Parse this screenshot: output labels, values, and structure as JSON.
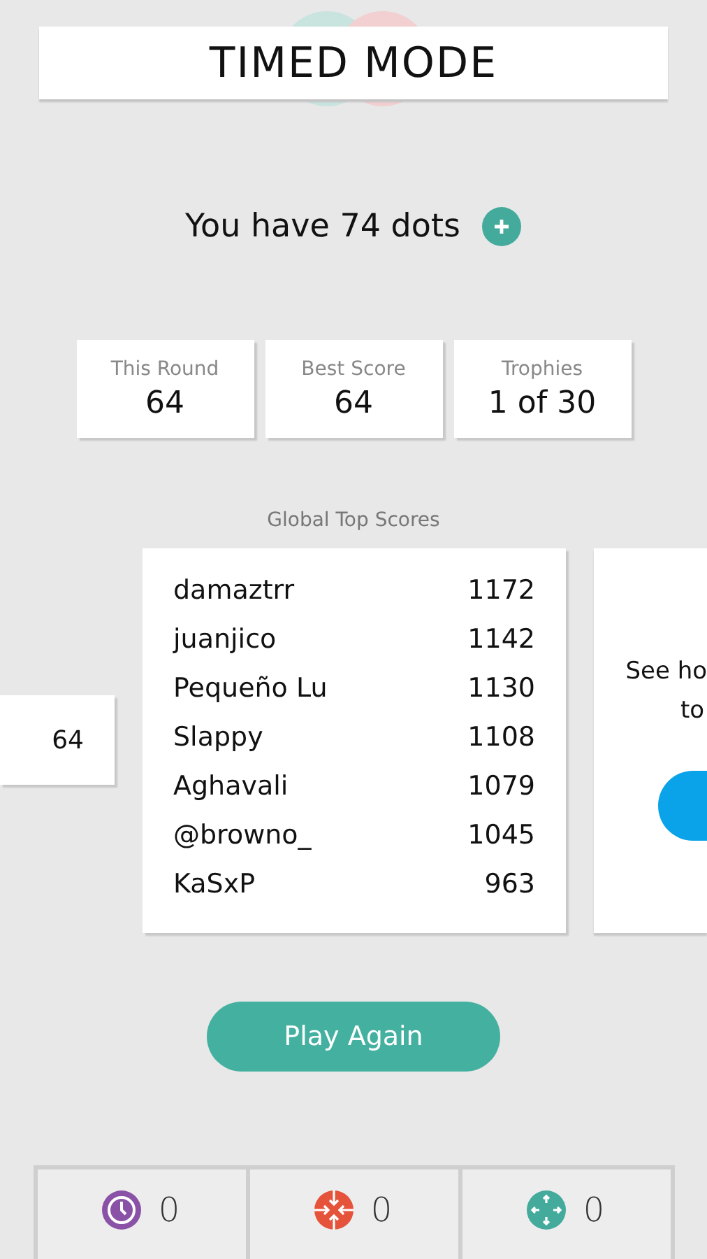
{
  "title": "TIMED MODE",
  "dots": {
    "text": "You have 74 dots"
  },
  "stats": [
    {
      "label": "This Round",
      "value": "64"
    },
    {
      "label": "Best Score",
      "value": "64"
    },
    {
      "label": "Trophies",
      "value": "1 of 30"
    }
  ],
  "leaderboard": {
    "title": "Global Top Scores",
    "previous_card": {
      "value": "64"
    },
    "rows": [
      {
        "name": "damaztrr",
        "score": "1172"
      },
      {
        "name": "juanjico",
        "score": "1142"
      },
      {
        "name": "Pequeño Lu",
        "score": "1130"
      },
      {
        "name": "Slappy",
        "score": "1108"
      },
      {
        "name": "Aghavali",
        "score": "1079"
      },
      {
        "name": "@browno_",
        "score": "1045"
      },
      {
        "name": "KaSxP",
        "score": "963"
      }
    ],
    "next_card": {
      "lines": [
        "See ho",
        "to"
      ]
    }
  },
  "play_button": "Play Again",
  "powerups": [
    {
      "kind": "clock",
      "count": "0"
    },
    {
      "kind": "shrinker",
      "count": "0"
    },
    {
      "kind": "expander",
      "count": "0"
    }
  ]
}
